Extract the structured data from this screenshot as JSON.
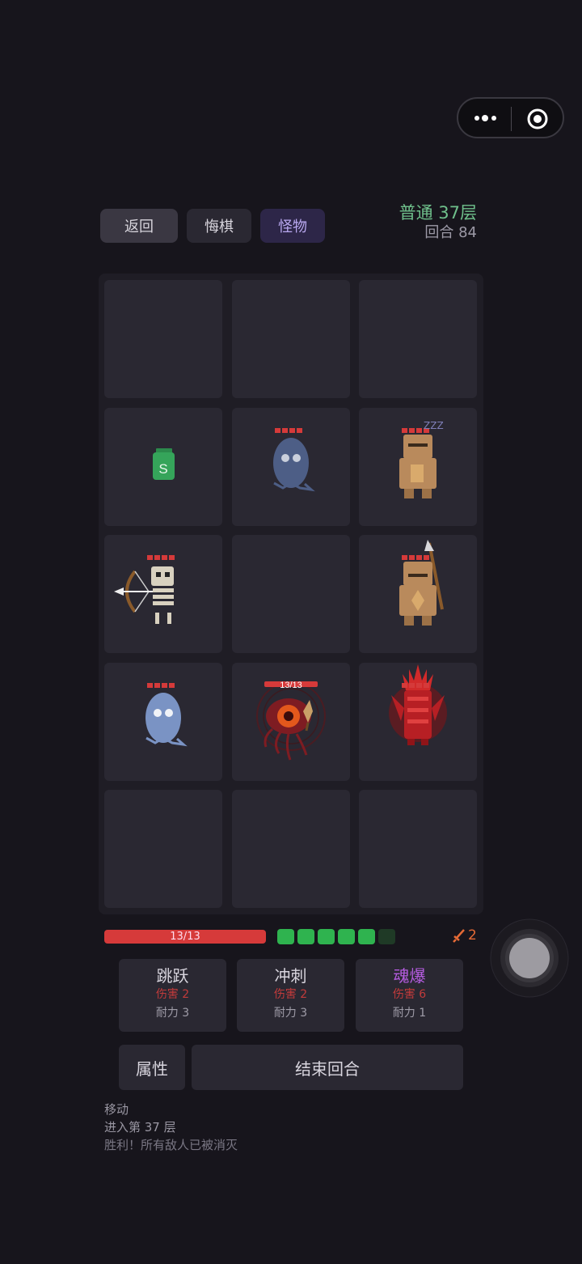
{
  "header": {
    "back_label": "返回",
    "undo_label": "悔棋",
    "monster_label": "怪物",
    "floor_label": "普通 37层",
    "turn_label": "回合 84"
  },
  "board": {
    "rows": 5,
    "cols": 3,
    "cells": [
      [
        "empty",
        "empty",
        "empty"
      ],
      [
        "potion",
        "ghost-monster",
        "golem-monster-sleeping"
      ],
      [
        "skeleton-archer-monster",
        "empty",
        "spear-golem-monster"
      ],
      [
        "ghost-monster",
        "player-eye",
        "crimson-demon-monster"
      ],
      [
        "empty",
        "empty",
        "empty"
      ]
    ],
    "potion_letter": "S",
    "sleep_text": "ZZZ",
    "player_hp_label": "13/13"
  },
  "status": {
    "hp_label": "13/13",
    "hp_fraction": 1.0,
    "stamina_filled": 5,
    "stamina_total": 6,
    "attack_value": "2"
  },
  "skills": [
    {
      "name": "跳跃",
      "damage": "伤害 2",
      "cost": "耐力 3"
    },
    {
      "name": "冲刺",
      "damage": "伤害 2",
      "cost": "耐力 3"
    },
    {
      "name": "魂爆",
      "damage": "伤害 6",
      "cost": "耐力 1"
    }
  ],
  "actions": {
    "attributes_label": "属性",
    "end_turn_label": "结束回合"
  },
  "log": [
    "移动",
    "进入第 37 层",
    "胜利！所有敌人已被消灭"
  ],
  "colors": {
    "background": "#17151c",
    "hp": "#d63a3a",
    "stamina": "#2fb34f",
    "floor_text": "#6fc08b",
    "soul_skill": "#b55ce0"
  }
}
